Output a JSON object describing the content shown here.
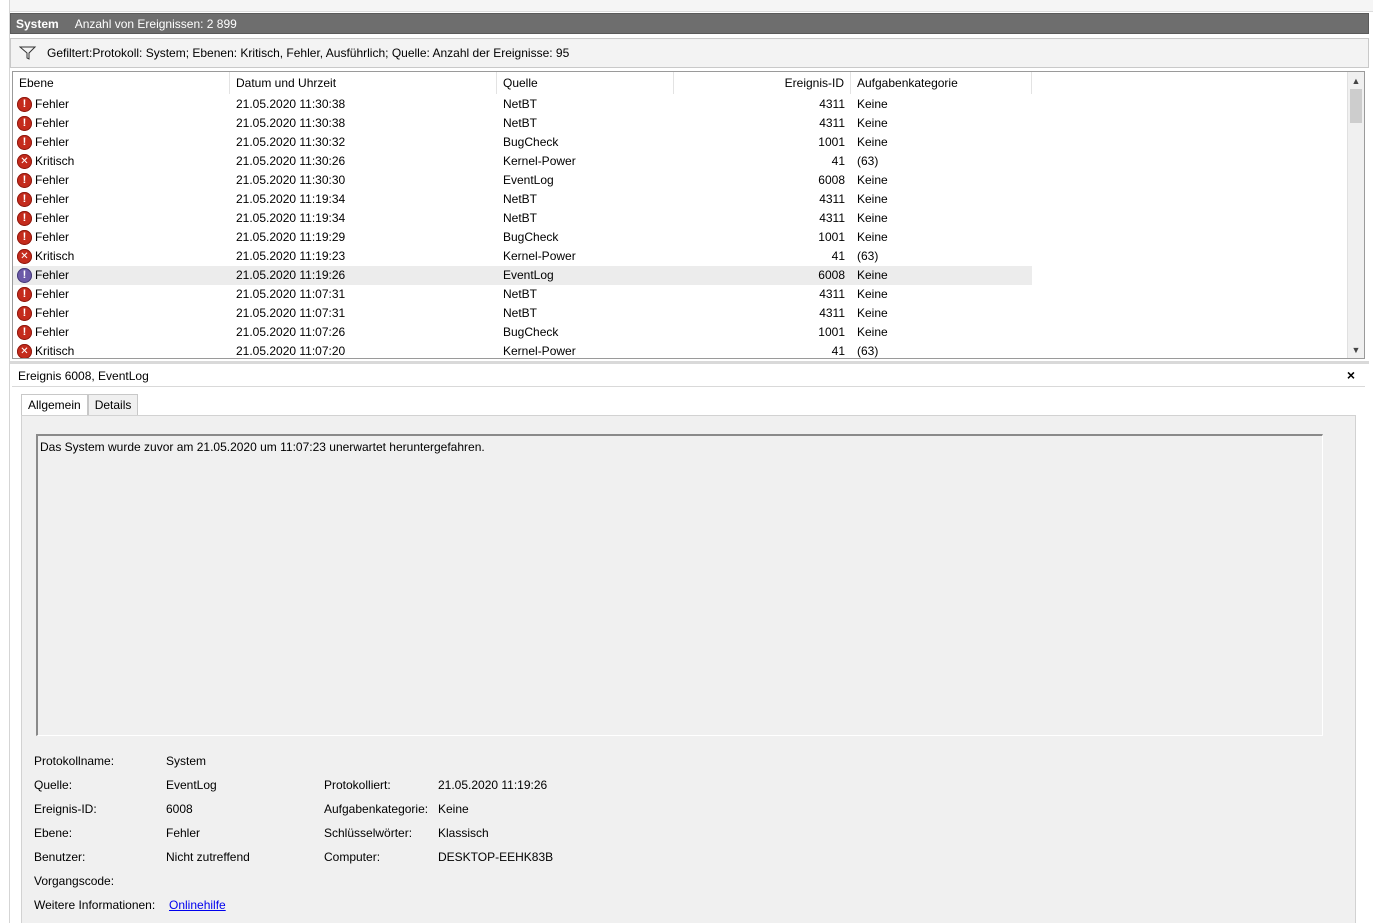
{
  "titlebar": {
    "log_name": "System",
    "event_count": "Anzahl von Ereignissen: 2 899"
  },
  "filter": {
    "text": "Gefiltert:Protokoll: System; Ebenen: Kritisch, Fehler, Ausführlich; Quelle:  Anzahl der Ereignisse: 95"
  },
  "columns": [
    "Ebene",
    "Datum und Uhrzeit",
    "Quelle",
    "Ereignis-ID",
    "Aufgabenkategorie"
  ],
  "rows": [
    {
      "level": "Fehler",
      "icon": "error-icon",
      "date": "21.05.2020 11:30:38",
      "source": "NetBT",
      "id": "4311",
      "category": "Keine"
    },
    {
      "level": "Fehler",
      "icon": "error-icon",
      "date": "21.05.2020 11:30:38",
      "source": "NetBT",
      "id": "4311",
      "category": "Keine"
    },
    {
      "level": "Fehler",
      "icon": "error-icon",
      "date": "21.05.2020 11:30:32",
      "source": "BugCheck",
      "id": "1001",
      "category": "Keine"
    },
    {
      "level": "Kritisch",
      "icon": "critical-icon",
      "date": "21.05.2020 11:30:26",
      "source": "Kernel-Power",
      "id": "41",
      "category": "(63)"
    },
    {
      "level": "Fehler",
      "icon": "error-icon",
      "date": "21.05.2020 11:30:30",
      "source": "EventLog",
      "id": "6008",
      "category": "Keine"
    },
    {
      "level": "Fehler",
      "icon": "error-icon",
      "date": "21.05.2020 11:19:34",
      "source": "NetBT",
      "id": "4311",
      "category": "Keine"
    },
    {
      "level": "Fehler",
      "icon": "error-icon",
      "date": "21.05.2020 11:19:34",
      "source": "NetBT",
      "id": "4311",
      "category": "Keine"
    },
    {
      "level": "Fehler",
      "icon": "error-icon",
      "date": "21.05.2020 11:19:29",
      "source": "BugCheck",
      "id": "1001",
      "category": "Keine"
    },
    {
      "level": "Kritisch",
      "icon": "critical-icon",
      "date": "21.05.2020 11:19:23",
      "source": "Kernel-Power",
      "id": "41",
      "category": "(63)"
    },
    {
      "level": "Fehler",
      "icon": "error-icon",
      "date": "21.05.2020 11:19:26",
      "source": "EventLog",
      "id": "6008",
      "category": "Keine",
      "selected": true
    },
    {
      "level": "Fehler",
      "icon": "error-icon",
      "date": "21.05.2020 11:07:31",
      "source": "NetBT",
      "id": "4311",
      "category": "Keine"
    },
    {
      "level": "Fehler",
      "icon": "error-icon",
      "date": "21.05.2020 11:07:31",
      "source": "NetBT",
      "id": "4311",
      "category": "Keine"
    },
    {
      "level": "Fehler",
      "icon": "error-icon",
      "date": "21.05.2020 11:07:26",
      "source": "BugCheck",
      "id": "1001",
      "category": "Keine"
    },
    {
      "level": "Kritisch",
      "icon": "critical-icon",
      "date": "21.05.2020 11:07:20",
      "source": "Kernel-Power",
      "id": "41",
      "category": "(63)"
    }
  ],
  "detail": {
    "title": "Ereignis 6008, EventLog",
    "close": "×",
    "tabs": [
      "Allgemein",
      "Details"
    ],
    "message": "Das System wurde zuvor am 21.05.2020 um 11:07:23 unerwartet heruntergefahren.",
    "props": {
      "log_label": "Protokollname:",
      "log_value": "System",
      "source_label": "Quelle:",
      "source_value": "EventLog",
      "logged_label": "Protokolliert:",
      "logged_value": "21.05.2020 11:19:26",
      "id_label": "Ereignis-ID:",
      "id_value": "6008",
      "task_label": "Aufgabenkategorie:",
      "task_value": "Keine",
      "level_label": "Ebene:",
      "level_value": "Fehler",
      "keywords_label": "Schlüsselwörter:",
      "keywords_value": "Klassisch",
      "user_label": "Benutzer:",
      "user_value": "Nicht zutreffend",
      "computer_label": "Computer:",
      "computer_value": "DESKTOP-EEHK83B",
      "opcode_label": "Vorgangscode:",
      "more_label": "Weitere Informationen:",
      "more_link": "Onlinehilfe"
    }
  },
  "colors": {
    "error": "#c42b1c",
    "selected_row": "#ececec",
    "titlebar": "#6e6e6e",
    "link": "#0000ee"
  }
}
